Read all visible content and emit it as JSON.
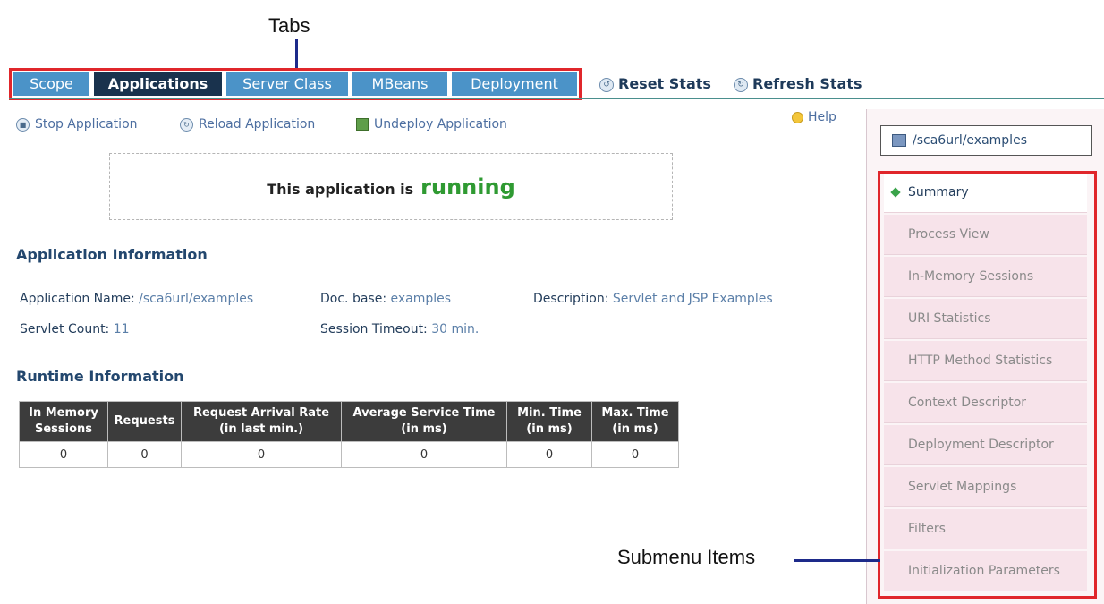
{
  "annotations": {
    "tabs_label": "Tabs",
    "submenu_label": "Submenu Items"
  },
  "tabs": [
    {
      "label": "Scope",
      "active": false
    },
    {
      "label": "Applications",
      "active": true
    },
    {
      "label": "Server Class",
      "active": false
    },
    {
      "label": "MBeans",
      "active": false
    },
    {
      "label": "Deployment",
      "active": false
    }
  ],
  "stats_actions": {
    "reset": "Reset Stats",
    "refresh": "Refresh Stats"
  },
  "app_actions": {
    "stop": "Stop Application",
    "reload": "Reload Application",
    "undeploy": "Undeploy Application",
    "help": "Help"
  },
  "status": {
    "prefix": "This application is",
    "state": "running"
  },
  "app_info": {
    "title": "Application Information",
    "name_label": "Application Name:",
    "name_value": "/sca6url/examples",
    "docbase_label": "Doc. base:",
    "docbase_value": "examples",
    "description_label": "Description:",
    "description_value": "Servlet and JSP Examples",
    "servlet_count_label": "Servlet Count:",
    "servlet_count_value": "11",
    "session_timeout_label": "Session Timeout:",
    "session_timeout_value": "30 min."
  },
  "runtime": {
    "title": "Runtime Information",
    "headers": [
      "In Memory Sessions",
      "Requests",
      "Request Arrival Rate (in last min.)",
      "Average Service Time (in ms)",
      "Min. Time (in ms)",
      "Max. Time (in ms)"
    ],
    "values": [
      "0",
      "0",
      "0",
      "0",
      "0",
      "0"
    ]
  },
  "sidebar": {
    "app_url": "/sca6url/examples",
    "items": [
      {
        "label": "Summary",
        "current": true
      },
      {
        "label": "Process View",
        "current": false
      },
      {
        "label": "In-Memory Sessions",
        "current": false
      },
      {
        "label": "URI Statistics",
        "current": false
      },
      {
        "label": "HTTP Method Statistics",
        "current": false
      },
      {
        "label": "Context Descriptor",
        "current": false
      },
      {
        "label": "Deployment Descriptor",
        "current": false
      },
      {
        "label": "Servlet Mappings",
        "current": false
      },
      {
        "label": "Filters",
        "current": false
      },
      {
        "label": "Initialization Parameters",
        "current": false
      }
    ]
  },
  "colors": {
    "tab_inactive": "#4b93c8",
    "tab_active": "#19324d",
    "running": "#2f9a32",
    "callout_border": "#e0262b",
    "submenu_bg": "#f7e3ea"
  }
}
